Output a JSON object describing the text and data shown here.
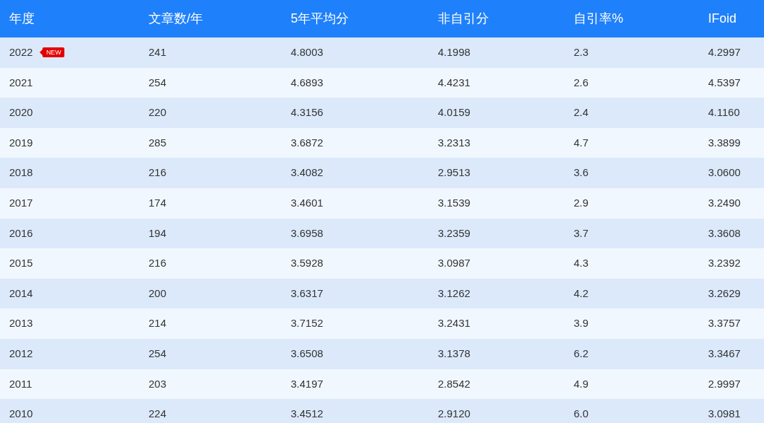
{
  "table": {
    "columns": [
      "年度",
      "文章数/年",
      "5年平均分",
      "非自引分",
      "自引率%",
      "IFoid"
    ],
    "rows": [
      {
        "cells": [
          "2022",
          "241",
          "4.8003",
          "4.1998",
          "2.3",
          "4.2997"
        ],
        "badge": "NEW"
      },
      {
        "cells": [
          "2021",
          "254",
          "4.6893",
          "4.4231",
          "2.6",
          "4.5397"
        ]
      },
      {
        "cells": [
          "2020",
          "220",
          "4.3156",
          "4.0159",
          "2.4",
          "4.1160"
        ]
      },
      {
        "cells": [
          "2019",
          "285",
          "3.6872",
          "3.2313",
          "4.7",
          "3.3899"
        ]
      },
      {
        "cells": [
          "2018",
          "216",
          "3.4082",
          "2.9513",
          "3.6",
          "3.0600"
        ]
      },
      {
        "cells": [
          "2017",
          "174",
          "3.4601",
          "3.1539",
          "2.9",
          "3.2490"
        ]
      },
      {
        "cells": [
          "2016",
          "194",
          "3.6958",
          "3.2359",
          "3.7",
          "3.3608"
        ]
      },
      {
        "cells": [
          "2015",
          "216",
          "3.5928",
          "3.0987",
          "4.3",
          "3.2392"
        ]
      },
      {
        "cells": [
          "2014",
          "200",
          "3.6317",
          "3.1262",
          "4.2",
          "3.2629"
        ]
      },
      {
        "cells": [
          "2013",
          "214",
          "3.7152",
          "3.2431",
          "3.9",
          "3.3757"
        ]
      },
      {
        "cells": [
          "2012",
          "254",
          "3.6508",
          "3.1378",
          "6.2",
          "3.3467"
        ]
      },
      {
        "cells": [
          "2011",
          "203",
          "3.4197",
          "2.8542",
          "4.9",
          "2.9997"
        ]
      },
      {
        "cells": [
          "2010",
          "224",
          "3.4512",
          "2.9120",
          "6.0",
          "3.0981"
        ]
      }
    ]
  }
}
